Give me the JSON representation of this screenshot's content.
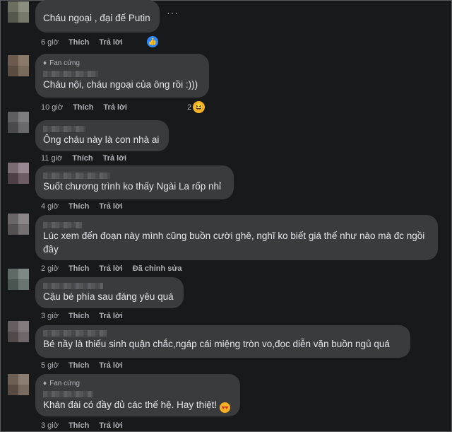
{
  "comments": [
    {
      "text": "Cháu ngoại , đại đế Putin",
      "time": "6 giờ",
      "like": "Thích",
      "reply": "Trả lời",
      "reaction": "like",
      "more": "···"
    },
    {
      "badge": "Fan cứng",
      "text": "Cháu nội, cháu ngoại của ông rồi :)))",
      "time": "10 giờ",
      "like": "Thích",
      "reply": "Trả lời",
      "reaction_count": "2",
      "reaction": "haha"
    },
    {
      "text": "Ông cháu này là con nhà ai",
      "time": "11 giờ",
      "like": "Thích",
      "reply": "Trả lời"
    },
    {
      "text": "Suốt chương trình ko thấy Ngài La rốp nhỉ",
      "time": "4 giờ",
      "like": "Thích",
      "reply": "Trả lời"
    },
    {
      "text": "Lúc xem đến đoạn này mình cũng buồn cười ghê, nghĩ ko biết giá thế như nào mà đc ngồi đây",
      "time": "2 giờ",
      "like": "Thích",
      "reply": "Trả lời",
      "edited": "Đã chỉnh sửa"
    },
    {
      "text": "Cậu bé phía sau đáng yêu quá",
      "time": "3 giờ",
      "like": "Thích",
      "reply": "Trả lời"
    },
    {
      "text": "Bé nầy là thiếu sinh quận chắc,ngáp cái miệng tròn vo,đọc diễn vặn buồn ngủ quá",
      "time": "5 giờ",
      "like": "Thích",
      "reply": "Trả lời"
    },
    {
      "badge": "Fan cứng",
      "text": "Khán đài có đầy đủ các thế hệ. Hay thiệt!",
      "time": "3 giờ",
      "like": "Thích",
      "reply": "Trả lời"
    }
  ],
  "icons": {
    "fan_badge": "diamond-icon",
    "like_reaction": "thumbs-up-icon",
    "haha_reaction": "haha-icon",
    "emoji": "heart-eyes-icon"
  }
}
